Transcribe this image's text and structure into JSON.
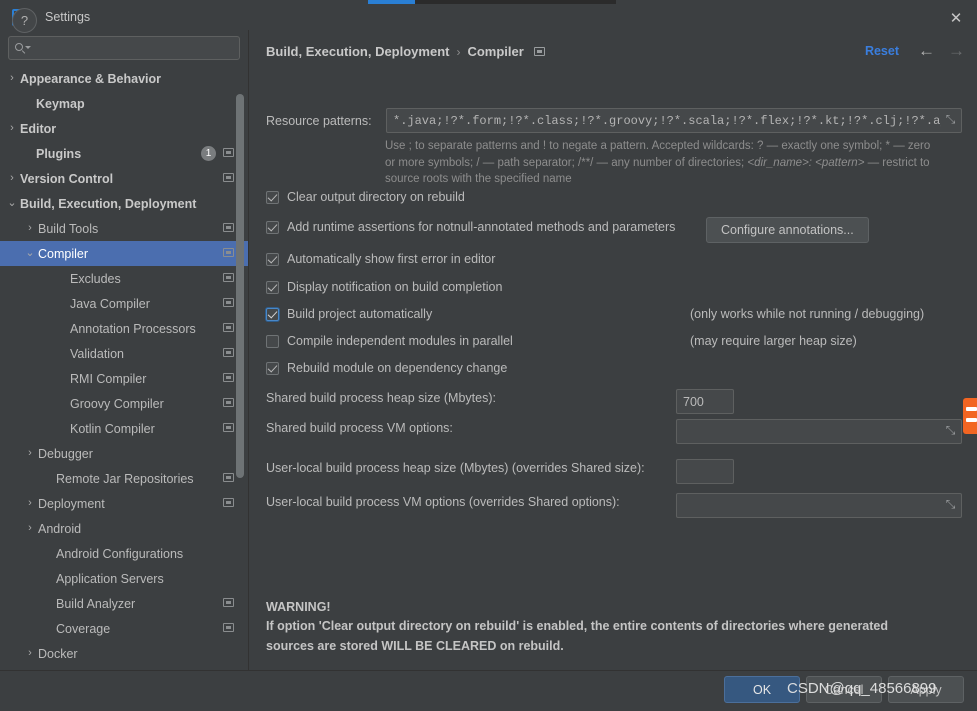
{
  "window": {
    "title": "Settings",
    "logo_text": "IJ",
    "close_label": "✕"
  },
  "sidebar": {
    "search": {
      "value": "",
      "placeholder": ""
    },
    "items": [
      {
        "label": "Appearance & Behavior",
        "arrow": "›",
        "indent": 8,
        "bold": true,
        "cfg": false,
        "badge": "",
        "selected": false
      },
      {
        "label": "Keymap",
        "arrow": "",
        "indent": 24,
        "bold": true,
        "cfg": false,
        "badge": "",
        "selected": false
      },
      {
        "label": "Editor",
        "arrow": "›",
        "indent": 8,
        "bold": true,
        "cfg": false,
        "badge": "",
        "selected": false
      },
      {
        "label": "Plugins",
        "arrow": "",
        "indent": 24,
        "bold": true,
        "cfg": true,
        "badge": "1",
        "selected": false
      },
      {
        "label": "Version Control",
        "arrow": "›",
        "indent": 8,
        "bold": true,
        "cfg": true,
        "badge": "",
        "selected": false
      },
      {
        "label": "Build, Execution, Deployment",
        "arrow": "⌄",
        "indent": 8,
        "bold": true,
        "cfg": false,
        "badge": "",
        "selected": false
      },
      {
        "label": "Build Tools",
        "arrow": "›",
        "indent": 26,
        "bold": false,
        "cfg": true,
        "badge": "",
        "selected": false
      },
      {
        "label": "Compiler",
        "arrow": "⌄",
        "indent": 26,
        "bold": false,
        "cfg": true,
        "badge": "",
        "selected": true
      },
      {
        "label": "Excludes",
        "arrow": "",
        "indent": 58,
        "bold": false,
        "cfg": true,
        "badge": "",
        "selected": false
      },
      {
        "label": "Java Compiler",
        "arrow": "",
        "indent": 58,
        "bold": false,
        "cfg": true,
        "badge": "",
        "selected": false
      },
      {
        "label": "Annotation Processors",
        "arrow": "",
        "indent": 58,
        "bold": false,
        "cfg": true,
        "badge": "",
        "selected": false
      },
      {
        "label": "Validation",
        "arrow": "",
        "indent": 58,
        "bold": false,
        "cfg": true,
        "badge": "",
        "selected": false
      },
      {
        "label": "RMI Compiler",
        "arrow": "",
        "indent": 58,
        "bold": false,
        "cfg": true,
        "badge": "",
        "selected": false
      },
      {
        "label": "Groovy Compiler",
        "arrow": "",
        "indent": 58,
        "bold": false,
        "cfg": true,
        "badge": "",
        "selected": false
      },
      {
        "label": "Kotlin Compiler",
        "arrow": "",
        "indent": 58,
        "bold": false,
        "cfg": true,
        "badge": "",
        "selected": false
      },
      {
        "label": "Debugger",
        "arrow": "›",
        "indent": 26,
        "bold": false,
        "cfg": false,
        "badge": "",
        "selected": false
      },
      {
        "label": "Remote Jar Repositories",
        "arrow": "",
        "indent": 44,
        "bold": false,
        "cfg": true,
        "badge": "",
        "selected": false
      },
      {
        "label": "Deployment",
        "arrow": "›",
        "indent": 26,
        "bold": false,
        "cfg": true,
        "badge": "",
        "selected": false
      },
      {
        "label": "Android",
        "arrow": "›",
        "indent": 26,
        "bold": false,
        "cfg": false,
        "badge": "",
        "selected": false
      },
      {
        "label": "Android Configurations",
        "arrow": "",
        "indent": 44,
        "bold": false,
        "cfg": false,
        "badge": "",
        "selected": false
      },
      {
        "label": "Application Servers",
        "arrow": "",
        "indent": 44,
        "bold": false,
        "cfg": false,
        "badge": "",
        "selected": false
      },
      {
        "label": "Build Analyzer",
        "arrow": "",
        "indent": 44,
        "bold": false,
        "cfg": true,
        "badge": "",
        "selected": false
      },
      {
        "label": "Coverage",
        "arrow": "",
        "indent": 44,
        "bold": false,
        "cfg": true,
        "badge": "",
        "selected": false
      },
      {
        "label": "Docker",
        "arrow": "›",
        "indent": 26,
        "bold": false,
        "cfg": false,
        "badge": "",
        "selected": false
      }
    ]
  },
  "header": {
    "crumb_parent": "Build, Execution, Deployment",
    "crumb_sep": "›",
    "crumb_current": "Compiler",
    "reset_label": "Reset",
    "back_arrow": "←",
    "forward_arrow": "→"
  },
  "main": {
    "resource_patterns_label": "Resource patterns:",
    "resource_patterns_value": "*.java;!?*.form;!?*.class;!?*.groovy;!?*.scala;!?*.flex;!?*.kt;!?*.clj;!?*.aj",
    "expand_glyph": "⤡",
    "hint_line1": "Use ; to separate patterns and ! to negate a pattern. Accepted wildcards: ? — exactly one symbol; * — zero",
    "hint_line2_a": "or more symbols; / — path separator; /**/ — any number of directories;  ",
    "hint_line2_b": "<dir_name>: <pattern>",
    "hint_line2_c": " — restrict to",
    "hint_line3": "source roots with the specified name",
    "checkboxes": [
      {
        "label": "Clear output directory on rebuild",
        "checked": true,
        "focused": false
      },
      {
        "label": "Add runtime assertions for notnull-annotated methods and parameters",
        "checked": true,
        "focused": false
      },
      {
        "label": "Automatically show first error in editor",
        "checked": true,
        "focused": false
      },
      {
        "label": "Display notification on build completion",
        "checked": true,
        "focused": false
      },
      {
        "label": "Build project automatically",
        "checked": true,
        "focused": true
      },
      {
        "label": "Compile independent modules in parallel",
        "checked": false,
        "focused": false
      },
      {
        "label": "Rebuild module on dependency change",
        "checked": true,
        "focused": false
      }
    ],
    "configure_annotations_label": "Configure annotations...",
    "note_build_auto": "(only works while not running / debugging)",
    "note_parallel": "(may require larger heap size)",
    "fields": [
      {
        "label": "Shared build process heap size (Mbytes):",
        "value": "700",
        "wide": false
      },
      {
        "label": "Shared build process VM options:",
        "value": "",
        "wide": true
      },
      {
        "label": "User-local build process heap size (Mbytes) (overrides Shared size):",
        "value": "",
        "wide": false
      },
      {
        "label": "User-local build process VM options (overrides Shared options):",
        "value": "",
        "wide": true
      }
    ],
    "warning_title": "WARNING!",
    "warning_line1": "If option 'Clear output directory on rebuild' is enabled, the entire contents of directories where generated",
    "warning_line2": "sources are stored WILL BE CLEARED on rebuild."
  },
  "footer": {
    "help_label": "?",
    "ok_label": "OK",
    "cancel_label": "Cancel",
    "apply_label": "Apply",
    "watermark": "CSDN@qq_48566899"
  },
  "colors": {
    "accent_blue": "#2a7fd4",
    "selection_blue": "#4b6eaf",
    "link_blue": "#3a7ede",
    "ok_button": "#365880",
    "panel_bg": "#3c3f41",
    "field_bg": "#45484a"
  }
}
